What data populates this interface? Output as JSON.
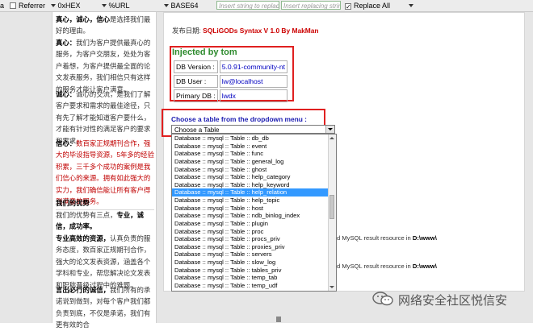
{
  "toolbar": {
    "first": "a",
    "referrer": "Referrer",
    "hex": "0xHEX",
    "url": "%URL",
    "base64": "BASE64",
    "insert_placeholder": "Insert string to replace",
    "replacing_placeholder": "Insert replacing string",
    "replace_all": "Replace All"
  },
  "sidebar": {
    "p1_lead": "真心，诚心，信心",
    "p1_rest": "是选择我们最好的理由。",
    "p2_lead": "真心：",
    "p2_rest": "我们为客户提供最真心的服务，为客户交朋友，处处为客户着想，为客户提供最全面的论文发表服务，我们相信只有这样的服务才能让客户满意。",
    "p3_lead": "诚心：",
    "p3_rest": "诚心的交流，是我们了解客户要求和需求的最佳途径，只有先了解才能知道客户要什么，才能有针对性的满足客户的要求和需求。",
    "p4_lead": "信心：",
    "p4_rest": "数百家正规期刊合作，强大的毕设指导资源，5年多的经验积累，三千多个成功的案例是我们信心的来源。拥有如此强大的实力，我们确信能让所有客户得到满意的服务。",
    "adv_head": "我们的优势",
    "adv_intro_a": "我们的优势有三点，",
    "adv_intro_b": "专业，诚信，成功率。",
    "adv1_lead": "专业高效的资源，",
    "adv1_rest": "认真负责的服务态度，数百家正规期刊合作，强大的论文发表资源，涵盖各个学科和专业，帮您解决论文发表和职称晋级过程中的难题。",
    "adv2_lead": "言出必行的诚信，",
    "adv2_rest": "我们所有的承诺说到做到，对每个客户我们都负责到底，不仅是承诺，我们有更有效的合"
  },
  "main": {
    "pubdate_label": "发布日期:",
    "pubdate_title": "SQLiGODs Syntax V 1.0 By MakMan",
    "injected": "Injected by tom",
    "info": [
      {
        "key": "DB Version :",
        "value": "5.0.91-community-nt"
      },
      {
        "key": "DB User :",
        "value": "lw@localhost"
      },
      {
        "key": "Primary DB :",
        "value": "lwdx"
      }
    ],
    "choose_label": "Choose a table from the dropdown menu :",
    "select_value": "Choose a Table",
    "dropdown_items": [
      "Database :: mysql :: Table :: db_db",
      "Database :: mysql :: Table :: event",
      "Database :: mysql :: Table :: func",
      "Database :: mysql :: Table :: general_log",
      "Database :: mysql :: Table :: ghost",
      "Database :: mysql :: Table :: help_category",
      "Database :: mysql :: Table :: help_keyword",
      "Database :: mysql :: Table :: help_relation",
      "Database :: mysql :: Table :: help_topic",
      "Database :: mysql :: Table :: host",
      "Database :: mysql :: Table :: ndb_binlog_index",
      "Database :: mysql :: Table :: plugin",
      "Database :: mysql :: Table :: proc",
      "Database :: mysql :: Table :: procs_priv",
      "Database :: mysql :: Table :: proxies_priv",
      "Database :: mysql :: Table :: servers",
      "Database :: mysql :: Table :: slow_log",
      "Database :: mysql :: Table :: tables_priv",
      "Database :: mysql :: Table :: temp_tab",
      "Database :: mysql :: Table :: temp_udf"
    ],
    "selected_index": 7,
    "warning_a": "d MySQL result resource in",
    "warning_b": "D:\\www\\"
  },
  "watermark": {
    "text": "网络安全社区悦信安"
  },
  "colors": {
    "accent_red": "#e02020",
    "title_red": "#cc0000",
    "injected_green": "#2e8b2e",
    "choose_blue": "#1a1ab0",
    "selected_blue": "#3399ff"
  }
}
